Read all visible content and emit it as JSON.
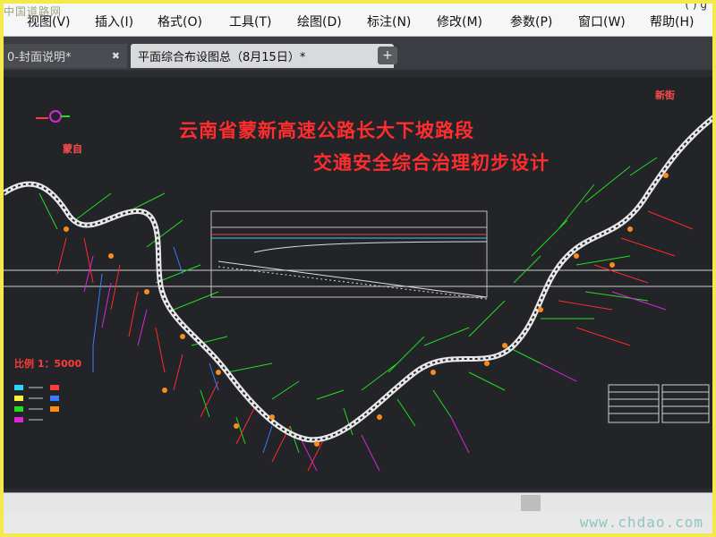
{
  "logo_watermark": "中国道路网",
  "title_fragment": "( ) g",
  "menu": [
    {
      "label": "视图(V)"
    },
    {
      "label": "插入(I)"
    },
    {
      "label": "格式(O)"
    },
    {
      "label": "工具(T)"
    },
    {
      "label": "绘图(D)"
    },
    {
      "label": "标注(N)"
    },
    {
      "label": "修改(M)"
    },
    {
      "label": "参数(P)"
    },
    {
      "label": "窗口(W)"
    },
    {
      "label": "帮助(H)"
    }
  ],
  "tabs": [
    {
      "label": "0-封面说明*",
      "close": "✖"
    },
    {
      "label": "平面综合布设图总（8月15日）*",
      "close": "✖"
    }
  ],
  "tab_add": "+",
  "drawing": {
    "title_line1": "云南省蒙新高速公路长大下坡路段",
    "title_line2": "交通安全综合治理初步设计",
    "left_label": "蒙自",
    "right_label": "新街",
    "scale": "比例 1：5000",
    "colors": {
      "background": "#222428",
      "title": "#ff2d2d",
      "road": "#e8e8e8",
      "lines_green": "#22dd22",
      "lines_red": "#ff2a2a",
      "lines_magenta": "#d926d9",
      "lines_blue": "#3a7bff"
    }
  },
  "watermark": "www.chdao.com"
}
